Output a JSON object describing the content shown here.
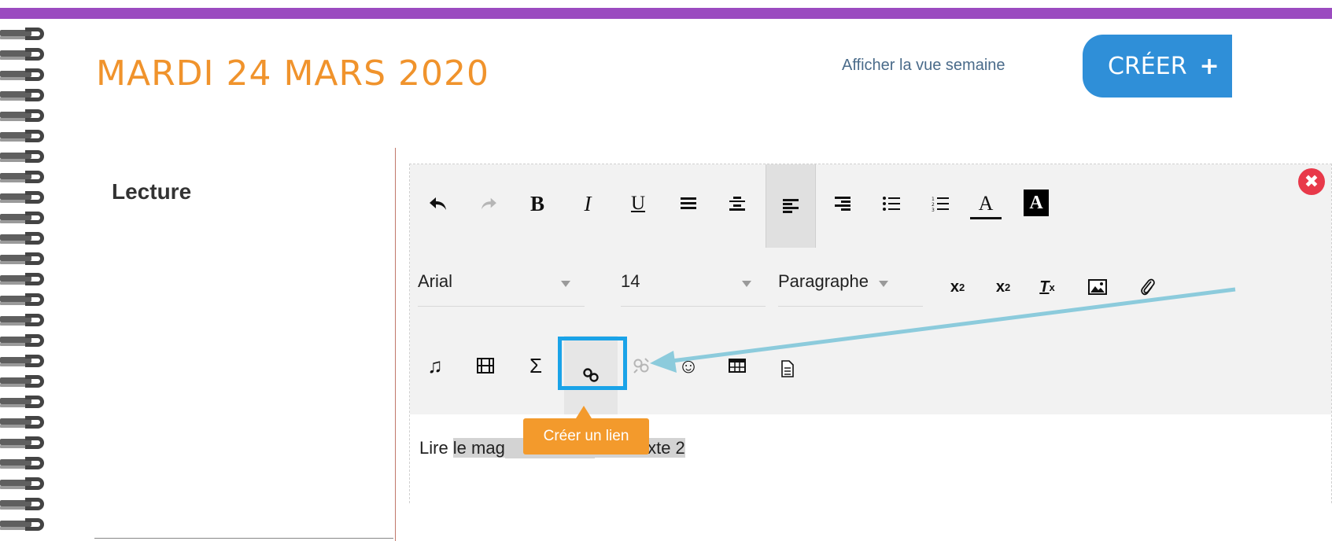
{
  "colors": {
    "purple_band": "#9b4bc0",
    "title_orange": "#f0932c",
    "create_blue": "#2f8fd8",
    "tooltip_orange": "#f39a2c",
    "close_red": "#e8394a",
    "highlight_blue": "#1aa3e8",
    "annotation_arrow": "#8ccbdc"
  },
  "header": {
    "date": "MARDI 24 MARS 2020",
    "week_view_link": "Afficher la vue semaine",
    "create_button": "CRÉER",
    "create_icon": "plus-icon"
  },
  "subject": {
    "label": "Lecture"
  },
  "editor": {
    "toolbar_row1_icons": [
      "undo-icon",
      "redo-icon",
      "bold-icon",
      "italic-icon",
      "underline-icon",
      "align-justify-icon",
      "align-center-icon",
      "align-left-icon",
      "align-right-icon",
      "bullet-list-icon",
      "numbered-list-icon",
      "text-color-icon",
      "background-color-icon"
    ],
    "glyphs": {
      "bold": "B",
      "italic": "I",
      "underline": "U",
      "text_color": "A",
      "bg_color": "A",
      "subscript_base": "x",
      "subscript_sub": "2",
      "superscript_base": "x",
      "superscript_sup": "2",
      "clear_format_base": "T",
      "clear_format_sub": "x",
      "sigma": "Σ",
      "music": "♫",
      "smiley": "☺"
    },
    "font_select": {
      "value": "Arial"
    },
    "size_select": {
      "value": "14"
    },
    "format_select": {
      "value": "Paragraphe"
    },
    "toolbar_row3_icons": [
      "music-icon",
      "video-icon",
      "formula-icon",
      "link-icon",
      "unlink-icon",
      "emoji-icon",
      "table-icon",
      "template-icon"
    ],
    "content_text": {
      "prefix": "Lire ",
      "highlighted_visible_1": "le mag",
      "highlighted_visible_2": "eurs texte 2"
    },
    "tooltip": "Créer un lien",
    "close_icon": "close-icon"
  }
}
